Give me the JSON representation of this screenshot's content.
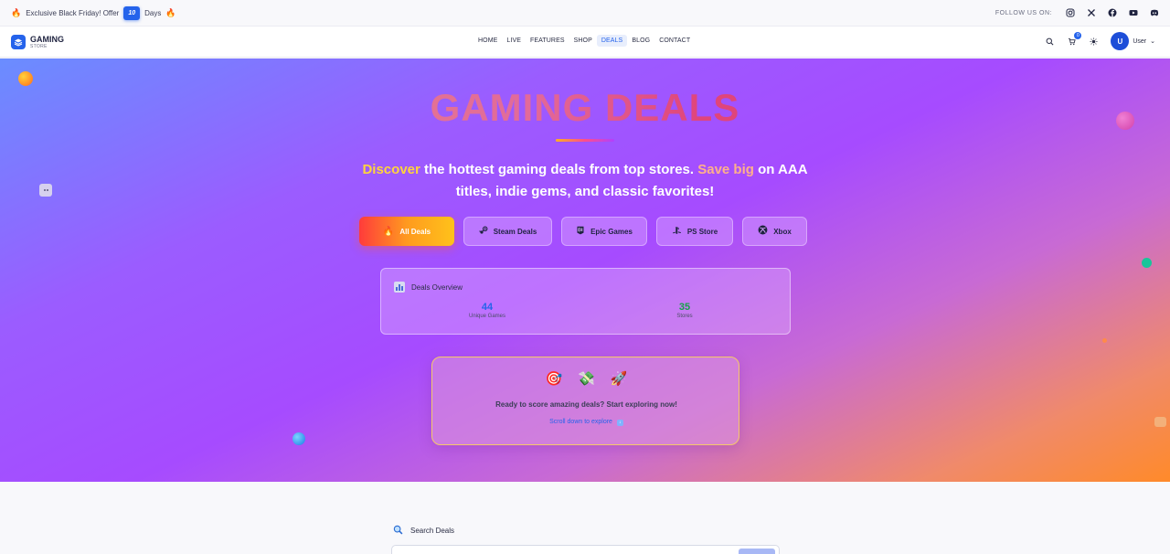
{
  "topbar": {
    "promo_text": "Exclusive Black Friday! Offer",
    "days_count": "10",
    "days_label": "Days",
    "follow_label": "FOLLOW US ON:",
    "socials": [
      "instagram-icon",
      "x-icon",
      "facebook-icon",
      "youtube-icon",
      "discord-icon"
    ]
  },
  "brand": {
    "name": "GAMING",
    "sub": "STORE"
  },
  "nav": {
    "items": [
      "HOME",
      "LIVE",
      "FEATURES",
      "SHOP",
      "DEALS",
      "BLOG",
      "CONTACT"
    ],
    "active": "DEALS"
  },
  "header_actions": {
    "cart_count": "0",
    "user_initial": "U",
    "user_name": "User"
  },
  "hero": {
    "title": "GAMING DEALS",
    "tagline_hl1": "Discover",
    "tagline_mid": " the hottest gaming deals from top stores. ",
    "tagline_hl2": "Save big",
    "tagline_end": " on AAA titles, indie gems, and classic favorites!",
    "stores": [
      {
        "label": "All Deals",
        "icon": "🔥"
      },
      {
        "label": "Steam Deals",
        "icon": "steam-icon"
      },
      {
        "label": "Epic Games",
        "icon": "epic-icon"
      },
      {
        "label": "PS Store",
        "icon": "playstation-icon"
      },
      {
        "label": "Xbox",
        "icon": "xbox-icon"
      }
    ],
    "overview": {
      "title": "Deals Overview",
      "unique_games_value": "44",
      "unique_games_label": "Unique Games",
      "stores_value": "35",
      "stores_label": "Stores"
    },
    "cta": {
      "icons": [
        "🎯",
        "💸",
        "🚀"
      ],
      "text": "Ready to score amazing deals? Start exploring now!",
      "link": "Scroll down to explore"
    }
  },
  "search": {
    "title": "Search Deals"
  },
  "colors": {
    "accent": "#2563eb",
    "stat_blue": "#2563eb",
    "stat_green": "#16a34a"
  }
}
